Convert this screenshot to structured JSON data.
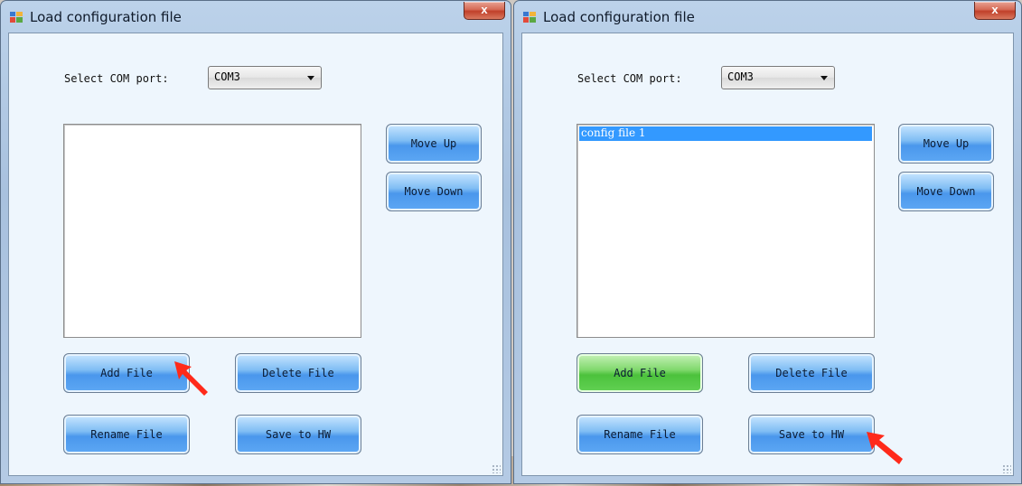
{
  "windows": [
    {
      "title": "Load configuration file",
      "close_label": "x",
      "com_label": "Select COM port:",
      "com_value": "COM3",
      "list_items": [],
      "buttons": {
        "move_up": "Move Up",
        "move_down": "Move Down",
        "add_file": "Add File",
        "delete_file": "Delete File",
        "rename_file": "Rename File",
        "save_to_hw": "Save to HW"
      },
      "add_file_state": "normal"
    },
    {
      "title": "Load configuration file",
      "close_label": "x",
      "com_label": "Select COM port:",
      "com_value": "COM3",
      "list_items": [
        "config file 1"
      ],
      "buttons": {
        "move_up": "Move Up",
        "move_down": "Move Down",
        "add_file": "Add File",
        "delete_file": "Delete File",
        "rename_file": "Rename File",
        "save_to_hw": "Save to HW"
      },
      "add_file_state": "highlighted"
    }
  ],
  "colors": {
    "button_blue": "#4a97ec",
    "button_green": "#4cc23c",
    "selection": "#3399ff",
    "annotation_arrow": "#ff2a1a"
  }
}
